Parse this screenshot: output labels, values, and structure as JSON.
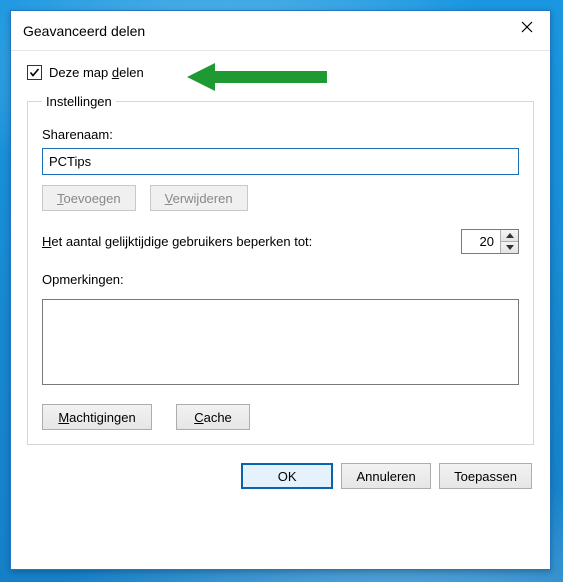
{
  "window": {
    "title": "Geavanceerd delen"
  },
  "share_checkbox": {
    "checked": true,
    "label_pre": "Deze map ",
    "label_u": "d",
    "label_post": "elen"
  },
  "group": {
    "legend": "Instellingen",
    "sharename_label": "Sharenaam:",
    "sharename_value": "PCTips",
    "add_btn_u": "T",
    "add_btn_rest": "oevoegen",
    "remove_btn_u": "V",
    "remove_btn_rest": "erwijderen",
    "limit_label_u": "H",
    "limit_label_rest": "et aantal gelijktijdige gebruikers beperken tot:",
    "limit_value": "20",
    "remarks_label": "Opmerkingen:",
    "remarks_value": "",
    "perm_btn_u": "M",
    "perm_btn_rest": "achtigingen",
    "cache_btn_u": "C",
    "cache_btn_rest": "ache"
  },
  "footer": {
    "ok": "OK",
    "cancel": "Annuleren",
    "apply": "Toepassen"
  }
}
